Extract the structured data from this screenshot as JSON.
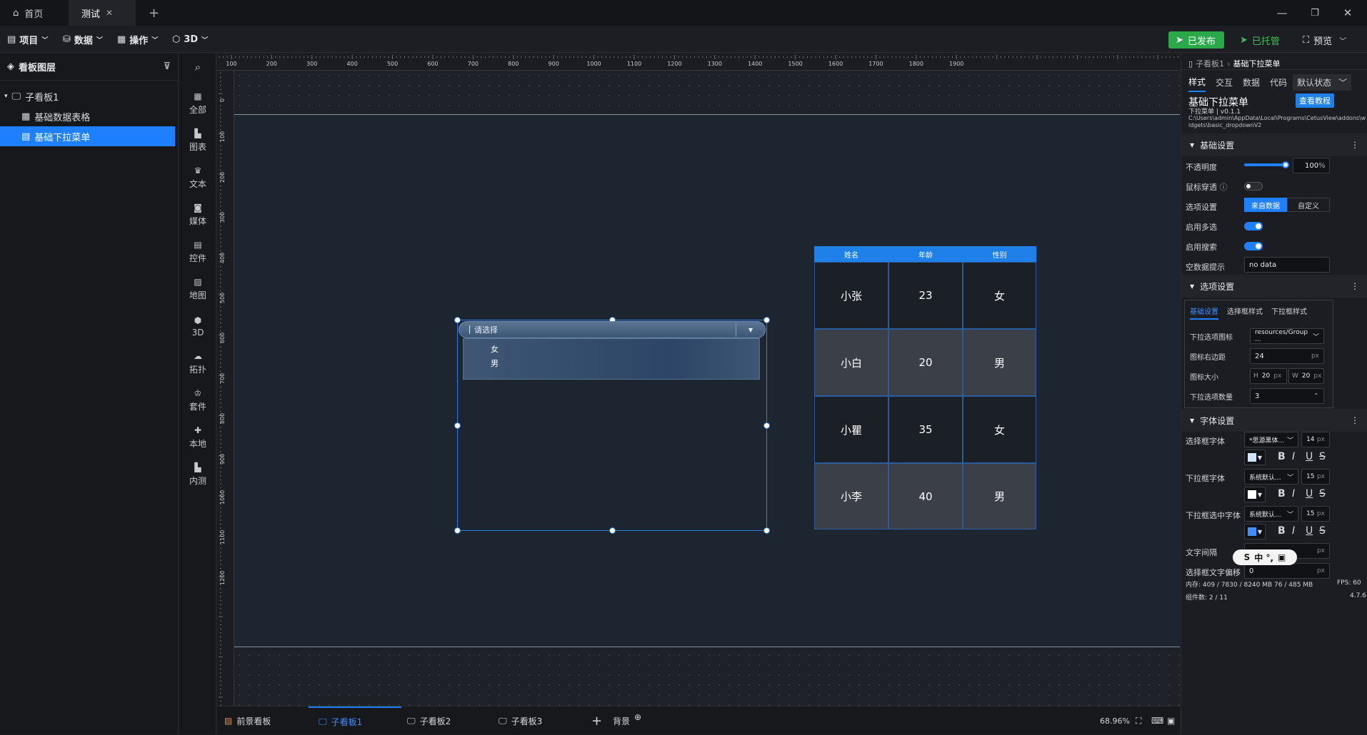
{
  "tabs": [
    {
      "label": "首页"
    },
    {
      "label": "测试"
    }
  ],
  "toolbar": {
    "menus": [
      {
        "label": "项目"
      },
      {
        "label": "数据"
      },
      {
        "label": "操作"
      },
      {
        "label": "3D"
      }
    ],
    "publish": "已发布",
    "hosted": "已托管",
    "preview": "预览"
  },
  "layers": {
    "title": "看板图层",
    "items": [
      {
        "label": "子看板1"
      },
      {
        "label": "基础数据表格"
      },
      {
        "label": "基础下拉菜单"
      }
    ]
  },
  "sidebar": {
    "items": [
      {
        "label": "全部"
      },
      {
        "label": "图表"
      },
      {
        "label": "文本"
      },
      {
        "label": "媒体"
      },
      {
        "label": "控件"
      },
      {
        "label": "地图"
      },
      {
        "label": "3D"
      },
      {
        "label": "拓扑"
      },
      {
        "label": "套件"
      },
      {
        "label": "本地"
      },
      {
        "label": "内测"
      }
    ]
  },
  "ruler": {
    "h_ticks": [
      "100",
      "200",
      "300",
      "400",
      "500",
      "600",
      "700",
      "800",
      "900",
      "1000",
      "1100",
      "1200",
      "1300",
      "1400",
      "1500",
      "1600",
      "1700",
      "1800",
      "1900"
    ],
    "v_ticks": [
      "0",
      "100",
      "200",
      "300",
      "400",
      "500",
      "600",
      "700",
      "800",
      "900",
      "1000",
      "1100",
      "1200"
    ]
  },
  "dropdown": {
    "placeholder": "请选择",
    "options": [
      "女",
      "男"
    ]
  },
  "table": {
    "headers": [
      "姓名",
      "年龄",
      "性别"
    ],
    "rows": [
      [
        "小张",
        "23",
        "女"
      ],
      [
        "小白",
        "20",
        "男"
      ],
      [
        "小瞿",
        "35",
        "女"
      ],
      [
        "小李",
        "40",
        "男"
      ]
    ]
  },
  "bottom": {
    "tabs": [
      {
        "label": "前景看板"
      },
      {
        "label": "子看板1"
      },
      {
        "label": "子看板2"
      },
      {
        "label": "子看板3"
      }
    ],
    "bg": "背景",
    "zoom": "68.96%"
  },
  "props": {
    "breadcrumb_parent": "子看板1",
    "breadcrumb_current": "基础下拉菜单",
    "tabs": [
      {
        "label": "样式"
      },
      {
        "label": "交互"
      },
      {
        "label": "数据"
      },
      {
        "label": "代码"
      }
    ],
    "state": "默认状态",
    "widget_name": "基础下拉菜单",
    "tutorial": "查看教程",
    "widget_version": "下拉菜单 | v0.1.1",
    "widget_path": "C:\\Users\\admin\\AppData\\Local\\Programs\\CetusView\\addons\\widgets\\basic_dropdownV2",
    "basic": {
      "title": "基础设置",
      "opacity_label": "不透明度",
      "opacity_value": "100",
      "opacity_unit": "%",
      "mouse_label": "鼠标穿透",
      "options_label": "选项设置",
      "opt_a": "来自数据",
      "opt_b": "自定义",
      "multi_label": "启用多选",
      "search_label": "启用搜索",
      "empty_label": "空数据提示",
      "empty_value": "no data"
    },
    "options": {
      "title": "选项设置",
      "subtabs": [
        {
          "label": "基础设置"
        },
        {
          "label": "选择框样式"
        },
        {
          "label": "下拉框样式"
        }
      ],
      "icon_label": "下拉选项图标",
      "icon_value": "resources/Group ...",
      "margin_label": "图标右边距",
      "margin_value": "24",
      "size_label": "图标大小",
      "h_label": "H",
      "h_value": "20",
      "w_label": "W",
      "w_value": "20",
      "count_label": "下拉选项数量",
      "count_value": "3",
      "unit": "px"
    },
    "font": {
      "title": "字体设置",
      "box_label": "选择框字体",
      "box_font": "*思源黑体...",
      "box_size": "14",
      "list_label": "下拉框字体",
      "list_font": "系统默认...",
      "list_size": "15",
      "sel_label": "下拉框选中字体",
      "sel_font": "系统默认...",
      "sel_size": "15",
      "spacing_label": "文字间隔",
      "offset_label": "选择框文字偏移",
      "offset_value": "0"
    },
    "status_memory": "内存: 409 / 7830 / 8240 MB 76 / 485 MB",
    "status_fps": "FPS: 60",
    "status_count": "组件数: 2 / 11",
    "version": "4.7.6"
  },
  "ime": "中 °,"
}
